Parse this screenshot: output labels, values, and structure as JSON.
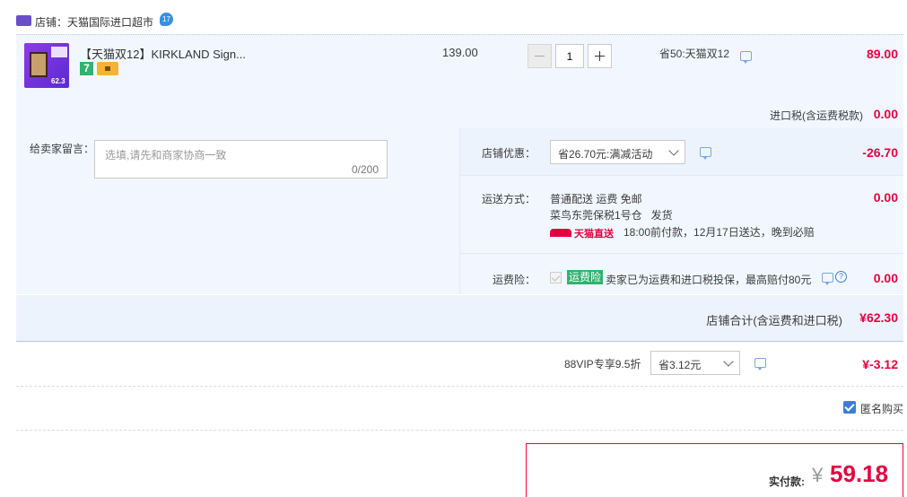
{
  "shop": {
    "label": "店铺：天猫国际进口超市"
  },
  "item": {
    "title": "【天猫双12】KIRKLAND Sign...",
    "unit_price": "139.00",
    "quantity": "1",
    "promo": "省50:天猫双12",
    "subtotal": "89.00",
    "thumb_price": "62.3"
  },
  "import_tax": {
    "label": "进口税(含运费税款)",
    "value": "0.00"
  },
  "message": {
    "label": "给卖家留言：",
    "placeholder": "选填,请先和商家协商一致",
    "counter": "0/200"
  },
  "shop_discount": {
    "label": "店铺优惠：",
    "selected": "省26.70元:满减活动",
    "value": "-26.70"
  },
  "shipping": {
    "label": "运送方式：",
    "line1": "普通配送 运费 免邮",
    "line2": "菜鸟东莞保税1号仓   发货",
    "tmall_direct": "天猫直送",
    "delivery_note": "18:00前付款，12月17日送达，晚到必赔",
    "value": "0.00"
  },
  "insurance": {
    "label": "运费险：",
    "badge": "运费险",
    "text": "卖家已为运费和进口税投保，最高赔付80元",
    "value": "0.00"
  },
  "shop_total": {
    "label": "店铺合计(含运费和进口税)",
    "value": "¥62.30"
  },
  "vip": {
    "label": "88VIP专享9.5折",
    "selected": "省3.12元",
    "value": "¥-3.12"
  },
  "anonymous": {
    "label": "匿名购买",
    "checked": true
  },
  "payment": {
    "label": "实付款:",
    "currency": "¥",
    "value": "59.18"
  },
  "colors": {
    "accent_red": "#e4003f",
    "link_blue": "#3d7ed6",
    "panel_bg": "#f2f7ff"
  },
  "icons": [
    "shop-icon",
    "coupon-bubble-icon",
    "minus-icon",
    "plus-icon",
    "chat-icon",
    "chevron-down-icon",
    "checkbox-icon",
    "help-icon",
    "tmall-direct-logo",
    "checked-checkbox-icon"
  ]
}
